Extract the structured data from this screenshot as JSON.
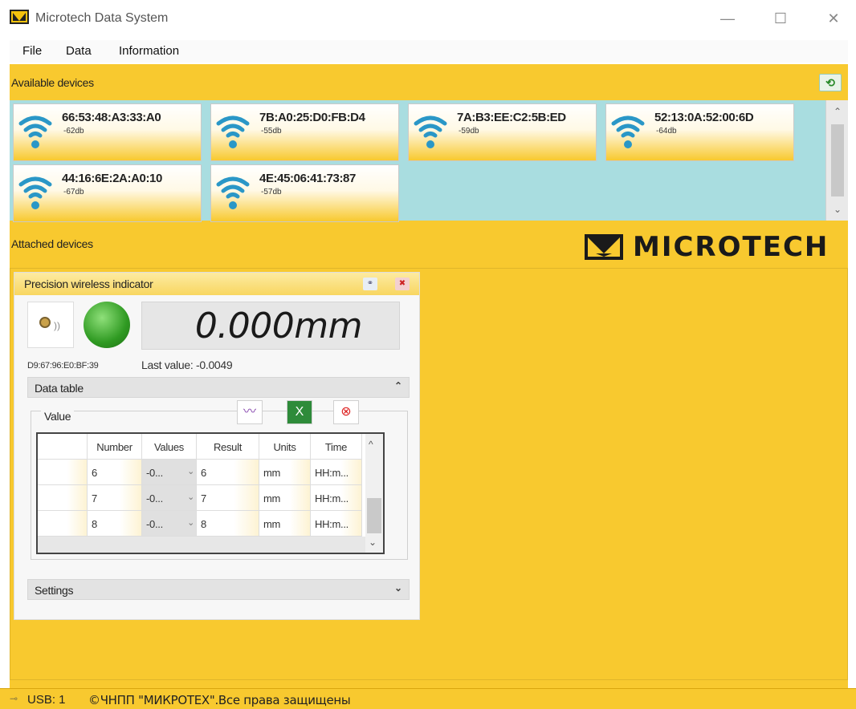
{
  "window": {
    "title": "Microtech Data System",
    "minimize": "—",
    "maximize": "☐",
    "close": "✕"
  },
  "menu": [
    "File",
    "Data",
    "Information"
  ],
  "available": {
    "label": "Available devices",
    "refresh_icon": "refresh-icon",
    "devices": [
      {
        "mac": "66:53:48:A3:33:A0",
        "signal": "-62db"
      },
      {
        "mac": "7B:A0:25:D0:FB:D4",
        "signal": "-55db"
      },
      {
        "mac": "7A:B3:EE:C2:5B:ED",
        "signal": "-59db"
      },
      {
        "mac": "52:13:0A:52:00:6D",
        "signal": "-64db"
      },
      {
        "mac": "44:16:6E:2A:A0:10",
        "signal": "-67db"
      },
      {
        "mac": "4E:45:06:41:73:87",
        "signal": "-57db"
      }
    ],
    "scroll_up": "⌃",
    "scroll_down": "⌄"
  },
  "attached": {
    "label": "Attached devices",
    "brand": "MICROTECH"
  },
  "indicator": {
    "title": "Precision wireless indicator",
    "reading": "0.000mm",
    "mac": "D9:67:96:E0:BF:39",
    "last_value": "Last value:  -0.0049",
    "data_table_label": "Data table",
    "collapse_glyph": "⌃",
    "value_group": "Value",
    "settings_label": "Settings",
    "expand_glyph": "⌄"
  },
  "table": {
    "columns": [
      "",
      "Number",
      "Values",
      "Result",
      "Units",
      "Time"
    ],
    "rows": [
      {
        "number": "6",
        "values": "-0...",
        "result": "6",
        "units": "mm",
        "time": "HH:m..."
      },
      {
        "number": "7",
        "values": "-0...",
        "result": "7",
        "units": "mm",
        "time": "HH:m..."
      },
      {
        "number": "8",
        "values": "-0...",
        "result": "8",
        "units": "mm",
        "time": "HH:m..."
      }
    ],
    "combo_arrow": "⌄",
    "scroll_up": "^",
    "scroll_down": "⌄"
  },
  "status": {
    "usb": "USB: 1",
    "copyright": "©ЧНПП \"МИКРОТЕХ\".Все права защищены"
  },
  "colors": {
    "accent": "#f8c92f",
    "devices_bg": "#a9dde0",
    "wifi": "#2a97c7",
    "led": "#2f9a22"
  }
}
